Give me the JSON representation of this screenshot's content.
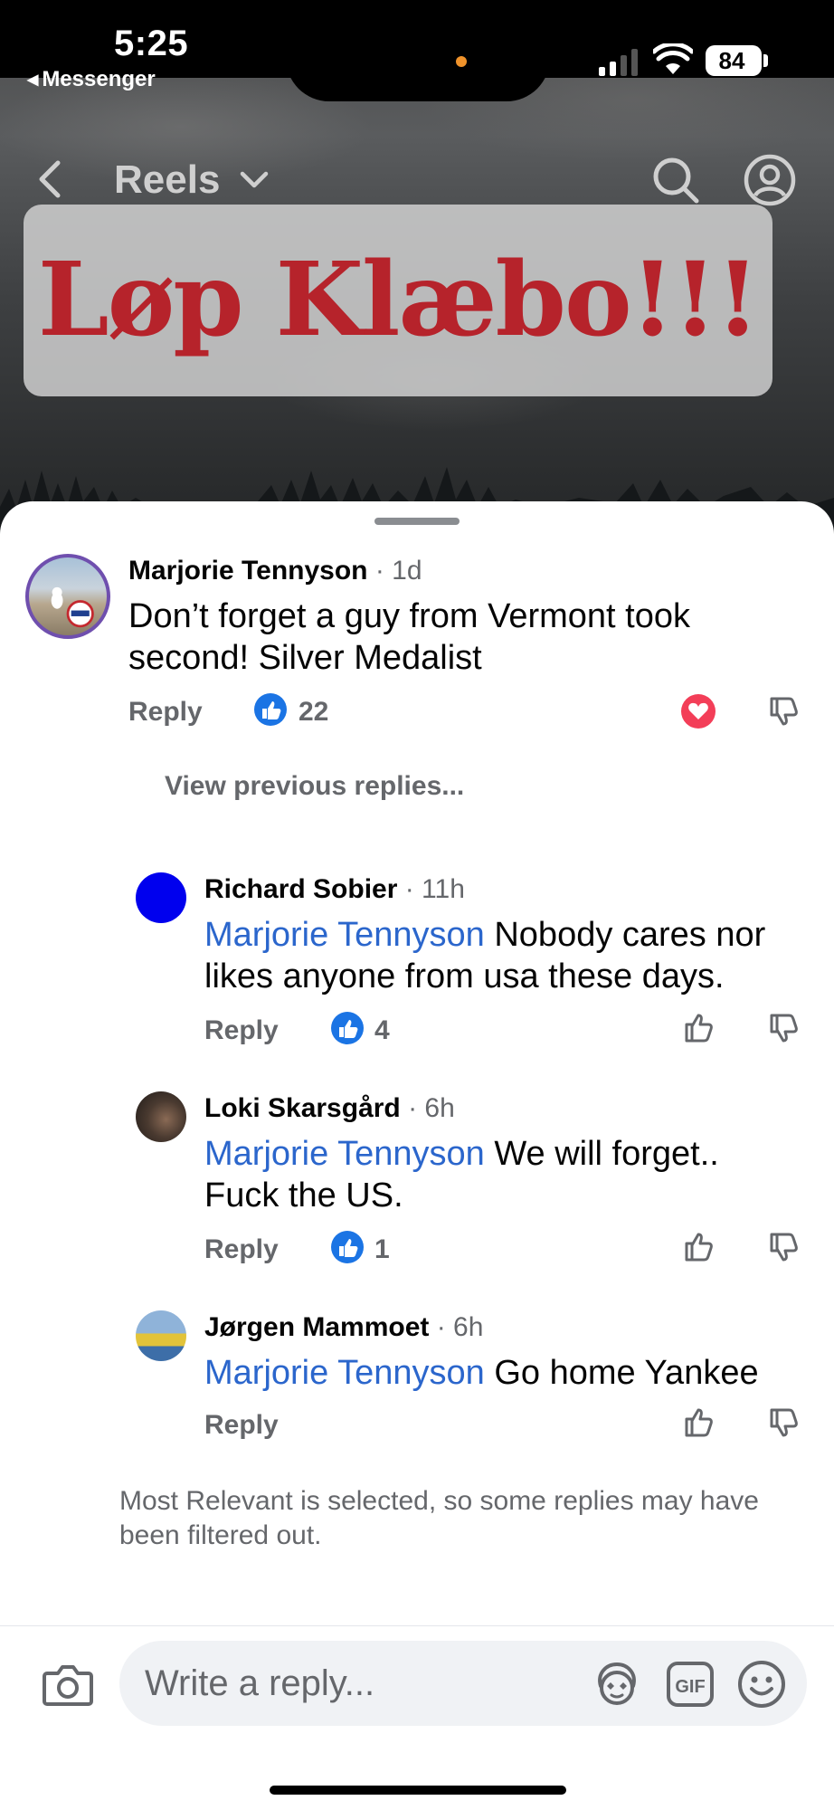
{
  "status": {
    "time": "5:25",
    "back_app": "Messenger",
    "battery": "84"
  },
  "header": {
    "title": "Reels"
  },
  "reel": {
    "banner_text": "Løp Klæbo!!!"
  },
  "comments": [
    {
      "author": "Marjorie Tennyson",
      "age": "· 1d",
      "text": "Don’t forget a guy from Vermont took second! Silver Medalist",
      "reply_label": "Reply",
      "likes": "22",
      "reaction": "love"
    },
    {
      "author": "Richard Sobier",
      "age": "· 11h",
      "mention": "Marjorie Tennyson",
      "text": " Nobody cares nor likes anyone from usa these days.",
      "reply_label": "Reply",
      "likes": "4"
    },
    {
      "author": "Loki Skarsgård",
      "age": "· 6h",
      "mention": "Marjorie Tennyson",
      "text": " We will forget.. Fuck the US.",
      "reply_label": "Reply",
      "likes": "1"
    },
    {
      "author": "Jørgen Mammoet",
      "age": "· 6h",
      "mention": "Marjorie Tennyson",
      "text": " Go home Yankee",
      "reply_label": "Reply"
    }
  ],
  "view_previous": "View previous replies...",
  "filter_note": "Most Relevant is selected, so some replies may have been filtered out.",
  "composer": {
    "placeholder": "Write a reply..."
  },
  "colors": {
    "accent": "#1b74e4",
    "mention": "#2b66cc",
    "love": "#f33e58",
    "banner_text": "#b6232b"
  }
}
